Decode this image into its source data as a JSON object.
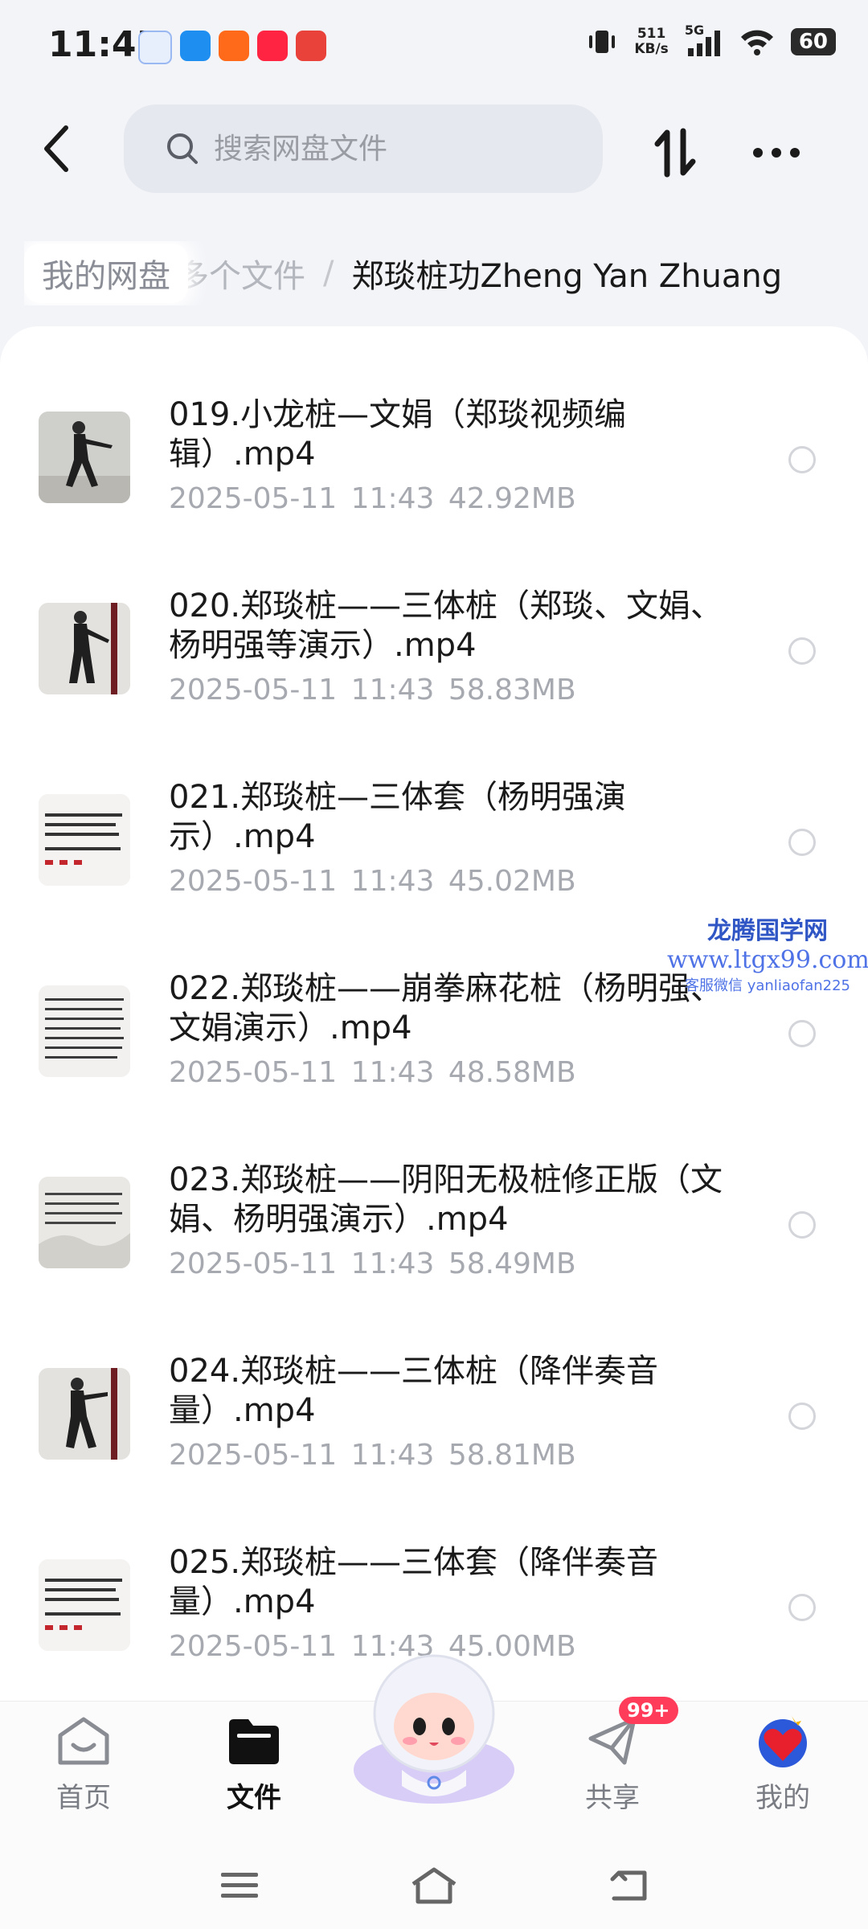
{
  "status_bar": {
    "time": "11:45",
    "net_speed_value": "511",
    "net_speed_unit": "KB/s",
    "signal_label": "5G",
    "battery": "60"
  },
  "search": {
    "placeholder": "搜索网盘文件"
  },
  "breadcrumb": {
    "root": "我的网盘",
    "middle": "多个文件",
    "separator": "/",
    "current": "郑琰桩功Zheng Yan Zhuang"
  },
  "files": [
    {
      "name": "019.小龙桩—文娟（郑琰视频编辑）.mp4",
      "date": "2025-05-11",
      "time": "11:43",
      "size": "42.92MB",
      "thumb": "person-photo"
    },
    {
      "name": "020.郑琰桩——三体桩（郑琰、文娟、杨明强等演示）.mp4",
      "date": "2025-05-11",
      "time": "11:43",
      "size": "58.83MB",
      "thumb": "person-photo"
    },
    {
      "name": "021.郑琰桩—三体套（杨明强演示）.mp4",
      "date": "2025-05-11",
      "time": "11:43",
      "size": "45.02MB",
      "thumb": "text-slide"
    },
    {
      "name": "022.郑琰桩——崩拳麻花桩（杨明强、文娟演示）.mp4",
      "date": "2025-05-11",
      "time": "11:43",
      "size": "48.58MB",
      "thumb": "text-slide"
    },
    {
      "name": "023.郑琰桩——阴阳无极桩修正版（文娟、杨明强演示）.mp4",
      "date": "2025-05-11",
      "time": "11:43",
      "size": "58.49MB",
      "thumb": "text-slide"
    },
    {
      "name": "024.郑琰桩——三体桩（降伴奏音量）.mp4",
      "date": "2025-05-11",
      "time": "11:43",
      "size": "58.81MB",
      "thumb": "person-photo"
    },
    {
      "name": "025.郑琰桩——三体套（降伴奏音量）.mp4",
      "date": "2025-05-11",
      "time": "11:43",
      "size": "45.00MB",
      "thumb": "text-slide"
    }
  ],
  "watermark": {
    "title": "龙腾国学网",
    "url": "www.ltgx99.com",
    "wechat": "客服微信 yanliaofan225"
  },
  "bottom_nav": {
    "items": [
      {
        "label": "首页",
        "icon": "home-icon"
      },
      {
        "label": "文件",
        "icon": "folder-icon"
      },
      {
        "label": "共享",
        "icon": "share-plane-icon"
      },
      {
        "label": "我的",
        "icon": "heart-avatar-icon"
      }
    ],
    "share_badge": "99+"
  },
  "colors": {
    "accent": "#2f56c4",
    "badge": "#ff3d5a",
    "muted": "#a7a9b0"
  }
}
